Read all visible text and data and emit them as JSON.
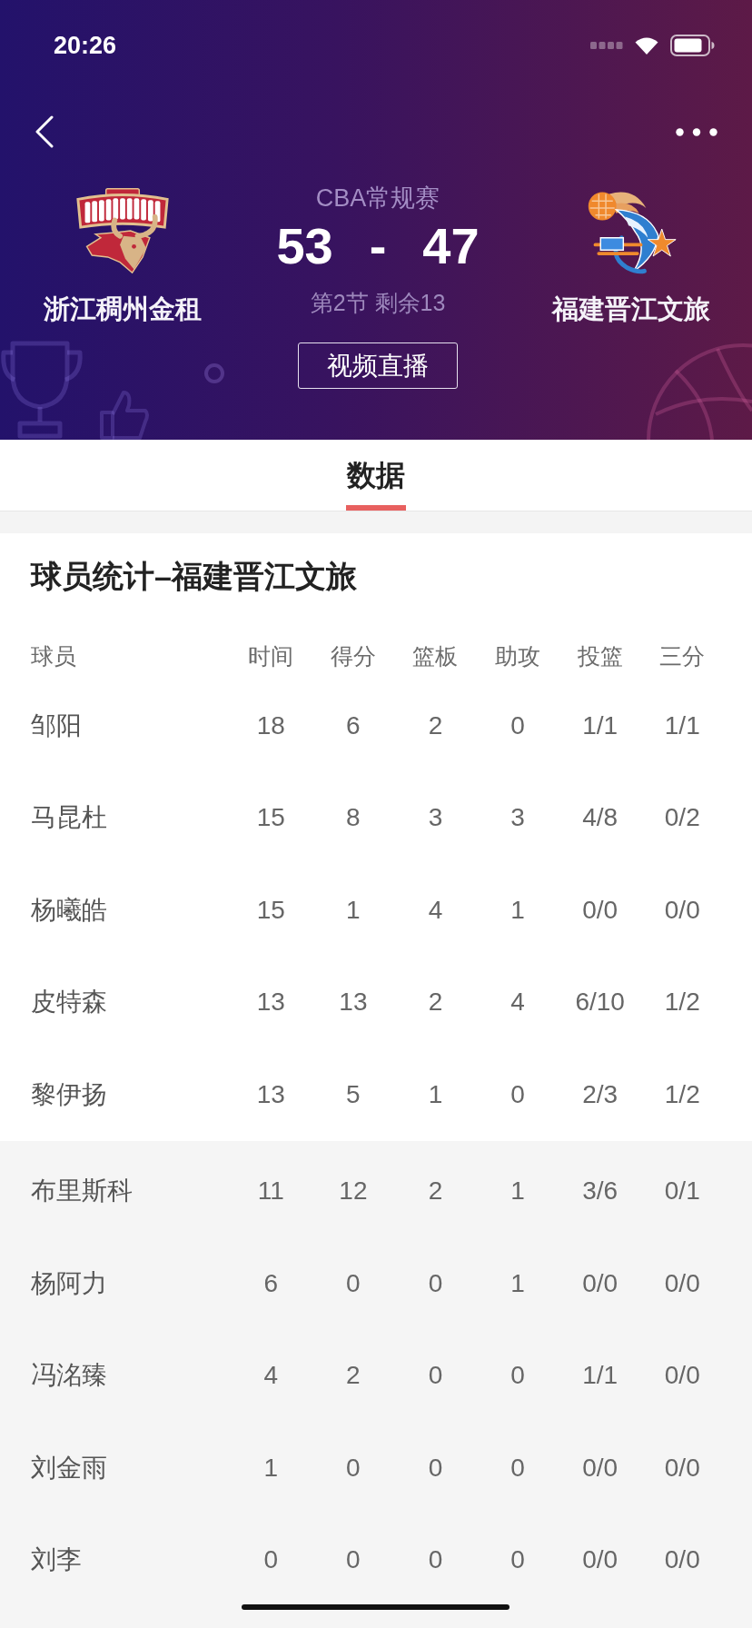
{
  "status_bar": {
    "time": "20:26"
  },
  "match": {
    "league": "CBA常规赛",
    "home_team": {
      "name": "浙江稠州金租",
      "score": "53"
    },
    "away_team": {
      "name": "福建晋江文旅",
      "score": "47"
    },
    "score_separator": "-",
    "period": "第2节 剩余13",
    "live_button": "视频直播"
  },
  "tabs": [
    {
      "label": "数据",
      "selected": true
    }
  ],
  "stats": {
    "title": "球员统计–福建晋江文旅",
    "columns": [
      "球员",
      "时间",
      "得分",
      "篮板",
      "助攻",
      "投篮",
      "三分"
    ],
    "rows": [
      {
        "player": "邹阳",
        "values": [
          "18",
          "6",
          "2",
          "0",
          "1/1",
          "1/1"
        ]
      },
      {
        "player": "马昆杜",
        "values": [
          "15",
          "8",
          "3",
          "3",
          "4/8",
          "0/2"
        ]
      },
      {
        "player": "杨曦皓",
        "values": [
          "15",
          "1",
          "4",
          "1",
          "0/0",
          "0/0"
        ]
      },
      {
        "player": "皮特森",
        "values": [
          "13",
          "13",
          "2",
          "4",
          "6/10",
          "1/2"
        ]
      },
      {
        "player": "黎伊扬",
        "values": [
          "13",
          "5",
          "1",
          "0",
          "2/3",
          "1/2"
        ]
      }
    ],
    "shaded_rows": [
      {
        "player": "布里斯科",
        "values": [
          "11",
          "12",
          "2",
          "1",
          "3/6",
          "0/1"
        ]
      },
      {
        "player": "杨阿力",
        "values": [
          "6",
          "0",
          "0",
          "1",
          "0/0",
          "0/0"
        ]
      },
      {
        "player": "冯洺臻",
        "values": [
          "4",
          "2",
          "0",
          "0",
          "1/1",
          "0/0"
        ]
      },
      {
        "player": "刘金雨",
        "values": [
          "1",
          "0",
          "0",
          "0",
          "0/0",
          "0/0"
        ]
      },
      {
        "player": "刘李",
        "values": [
          "0",
          "0",
          "0",
          "0",
          "0/0",
          "0/0"
        ]
      }
    ]
  }
}
